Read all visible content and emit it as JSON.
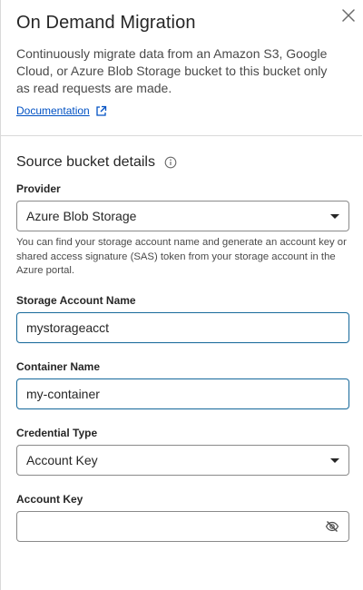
{
  "panel": {
    "title": "On Demand Migration",
    "description": "Continuously migrate data from an Amazon S3, Google Cloud, or Azure Blob Storage bucket to this bucket only as read requests are made.",
    "doc_link": "Documentation"
  },
  "source": {
    "section_title": "Source bucket details",
    "provider": {
      "label": "Provider",
      "value": "Azure Blob Storage",
      "helper": "You can find your storage account name and generate an account key or shared access signature (SAS) token from your storage account in the Azure portal."
    },
    "storage_account": {
      "label": "Storage Account Name",
      "value": "mystorageacct"
    },
    "container": {
      "label": "Container Name",
      "value": "my-container"
    },
    "credential_type": {
      "label": "Credential Type",
      "value": "Account Key"
    },
    "account_key": {
      "label": "Account Key",
      "value": ""
    }
  },
  "colors": {
    "accent": "#0051c3",
    "focus_border": "#1d6d9c",
    "border": "#8a8a8a",
    "divider": "#d9d9d9"
  },
  "icons": {
    "close": "close-icon",
    "external_link": "external-link-icon",
    "info": "info-icon",
    "dropdown": "chevron-down-icon",
    "visibility": "eye-off-icon"
  }
}
